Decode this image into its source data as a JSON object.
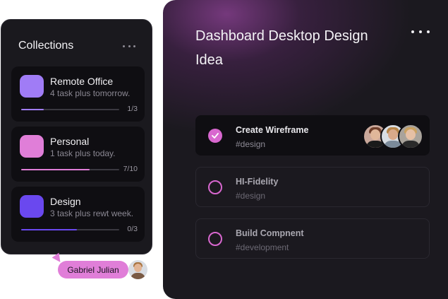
{
  "dashboard": {
    "title": "Dashboard Desktop Design Idea",
    "more_icon": "more-horizontal-icon",
    "tasks": [
      {
        "title": "Create Wireframe",
        "tag": "#design",
        "done": true
      },
      {
        "title": "HI-Fidelity",
        "tag": "#design",
        "done": false
      },
      {
        "title": "Build Compnent",
        "tag": "#development",
        "done": false
      }
    ]
  },
  "collections": {
    "title": "Collections",
    "more_icon": "more-horizontal-icon",
    "items": [
      {
        "title": "Remote Office",
        "subtitle": "4 task plus tomorrow.",
        "count": "1/3",
        "progress": 0.23,
        "color": "#a07cf6"
      },
      {
        "title": "Personal",
        "subtitle": "1 task plus today.",
        "count": "7/10",
        "progress": 0.7,
        "color": "#e07ed8"
      },
      {
        "title": "Design",
        "subtitle": "3 task plus rewt week.",
        "count": "0/3",
        "progress": 0.57,
        "color": "#6a48ef"
      }
    ]
  },
  "user_chip": {
    "name": "Gabriel Julian",
    "color": "#e07ed8"
  },
  "colors": {
    "accent": "#d867cf",
    "panel_bg": "#1b191f",
    "card_bg": "#0f0e12"
  }
}
